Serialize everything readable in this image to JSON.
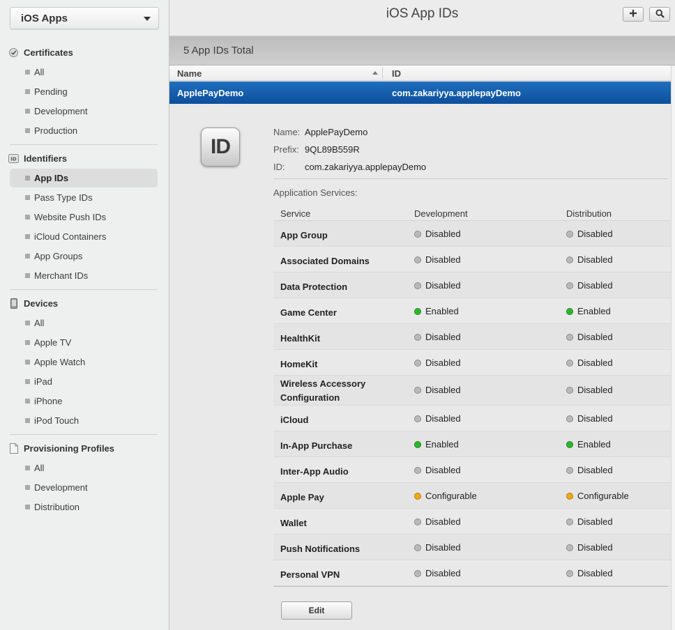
{
  "sidebar": {
    "platform": "iOS Apps",
    "sections": [
      {
        "title": "Certificates",
        "icon": "certificate-icon",
        "items": [
          "All",
          "Pending",
          "Development",
          "Production"
        ]
      },
      {
        "title": "Identifiers",
        "icon": "id-badge-icon",
        "items": [
          "App IDs",
          "Pass Type IDs",
          "Website Push IDs",
          "iCloud Containers",
          "App Groups",
          "Merchant IDs"
        ]
      },
      {
        "title": "Devices",
        "icon": "device-icon",
        "items": [
          "All",
          "Apple TV",
          "Apple Watch",
          "iPad",
          "iPhone",
          "iPod Touch"
        ]
      },
      {
        "title": "Provisioning Profiles",
        "icon": "document-icon",
        "items": [
          "All",
          "Development",
          "Distribution"
        ]
      }
    ],
    "selected": "App IDs"
  },
  "header": {
    "title": "iOS App IDs",
    "add_icon": "plus-icon",
    "search_icon": "search-icon"
  },
  "list": {
    "count_label": "5 App IDs Total",
    "columns": {
      "name": "Name",
      "id": "ID"
    },
    "selected_row": {
      "name": "ApplePayDemo",
      "id": "com.zakariyya.applepayDemo"
    }
  },
  "detail": {
    "icon_text": "ID",
    "name_label": "Name:",
    "name": "ApplePayDemo",
    "prefix_label": "Prefix:",
    "prefix": "9QL89B559R",
    "id_label": "ID:",
    "id": "com.zakariyya.applepayDemo",
    "services_title": "Application Services:",
    "services_columns": {
      "service": "Service",
      "development": "Development",
      "distribution": "Distribution"
    },
    "services": [
      {
        "name": "App Group",
        "development": "Disabled",
        "distribution": "Disabled"
      },
      {
        "name": "Associated Domains",
        "development": "Disabled",
        "distribution": "Disabled"
      },
      {
        "name": "Data Protection",
        "development": "Disabled",
        "distribution": "Disabled"
      },
      {
        "name": "Game Center",
        "development": "Enabled",
        "distribution": "Enabled"
      },
      {
        "name": "HealthKit",
        "development": "Disabled",
        "distribution": "Disabled"
      },
      {
        "name": "HomeKit",
        "development": "Disabled",
        "distribution": "Disabled"
      },
      {
        "name": "Wireless Accessory Configuration",
        "development": "Disabled",
        "distribution": "Disabled"
      },
      {
        "name": "iCloud",
        "development": "Disabled",
        "distribution": "Disabled"
      },
      {
        "name": "In-App Purchase",
        "development": "Enabled",
        "distribution": "Enabled"
      },
      {
        "name": "Inter-App Audio",
        "development": "Disabled",
        "distribution": "Disabled"
      },
      {
        "name": "Apple Pay",
        "development": "Configurable",
        "distribution": "Configurable"
      },
      {
        "name": "Wallet",
        "development": "Disabled",
        "distribution": "Disabled"
      },
      {
        "name": "Push Notifications",
        "development": "Disabled",
        "distribution": "Disabled"
      },
      {
        "name": "Personal VPN",
        "development": "Disabled",
        "distribution": "Disabled"
      }
    ],
    "status_colors": {
      "Disabled": "#b9b9b9",
      "Enabled": "#2db52d",
      "Configurable": "#f0a818"
    },
    "edit_label": "Edit"
  },
  "colors": {
    "selection": "#1560ad",
    "accent": "#0d4f9b"
  }
}
